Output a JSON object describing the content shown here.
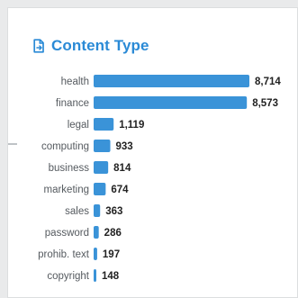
{
  "header": {
    "title": "Content Type",
    "icon": "document-export-icon",
    "accent_color": "#2a8ad6"
  },
  "chart_data": {
    "type": "bar",
    "orientation": "horizontal",
    "title": "Content Type",
    "categories": [
      "health",
      "finance",
      "legal",
      "computing",
      "business",
      "marketing",
      "sales",
      "password",
      "prohib. text",
      "copyright"
    ],
    "values": [
      8714,
      8573,
      1119,
      933,
      814,
      674,
      363,
      286,
      197,
      148
    ],
    "value_labels": [
      "8,714",
      "8,573",
      "1,119",
      "933",
      "814",
      "674",
      "363",
      "286",
      "197",
      "148"
    ],
    "bar_color": "#3a93d8",
    "grid": false,
    "legend": "none",
    "xlim": [
      0,
      8714
    ]
  }
}
